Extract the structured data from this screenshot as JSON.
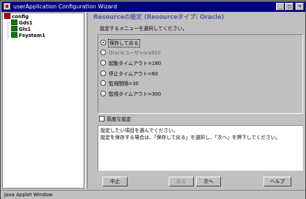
{
  "window": {
    "title": "userApplication Configuration Wizard",
    "minimize_glyph": "_",
    "maximize_glyph": "□",
    "close_glyph": "×"
  },
  "tree": {
    "root": {
      "label": "config",
      "icon": "config-folder-icon"
    },
    "children": [
      {
        "label": "Gds1",
        "icon": "resource-icon"
      },
      {
        "label": "Gls1",
        "icon": "resource-icon"
      },
      {
        "label": "Fsystem1",
        "icon": "resource-icon"
      }
    ]
  },
  "main": {
    "title": "Resourceの設定 (Resourceタイプ: Oracle)",
    "instruction": "設定するメニューを選択してください。",
    "menu_options": [
      {
        "label": "保存して戻る",
        "selected": true
      },
      {
        "label": "Oracleユーザ=ora920",
        "selected": false
      },
      {
        "label": "起動タイムアウト=180",
        "selected": false
      },
      {
        "label": "停止タイムアウト=60",
        "selected": false
      },
      {
        "label": "監視間隔=30",
        "selected": false
      },
      {
        "label": "監視タイムアウト=300",
        "selected": false
      }
    ],
    "advanced_label": "高度な設定",
    "advanced_checked": false,
    "description": [
      "設定したい項目を選んでください。",
      "設定を保存する場合は、「保存して戻る」を選択し、「次へ」を押下してください。"
    ]
  },
  "buttons": {
    "cancel": "中止",
    "back": "戻る",
    "next": "次へ",
    "help": "ヘルプ"
  },
  "status": "Java Applet Window",
  "colors": {
    "title_bar": "#000080",
    "heading_text": "#5a5aa0",
    "window_bg": "#c0c0c0"
  }
}
